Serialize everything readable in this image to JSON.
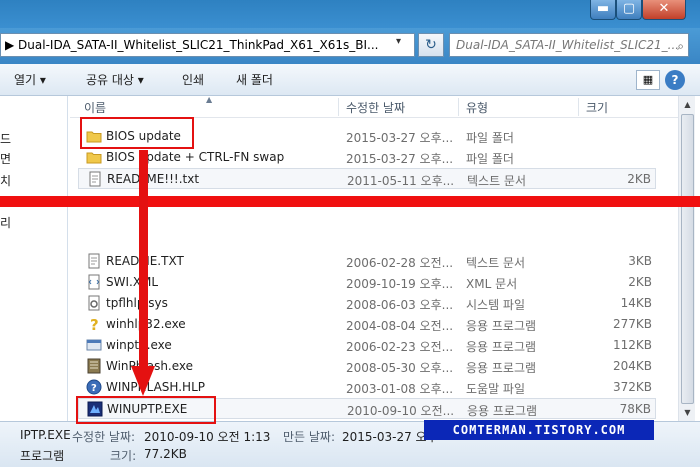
{
  "window": {
    "minimize_glyph": "▬",
    "maximize_glyph": "▢",
    "close_glyph": "✕"
  },
  "address": {
    "path": "▶ Dual-IDA_SATA-II_Whitelist_SLIC21_ThinkPad_X61_X61s_BI...",
    "chevron": "▾",
    "refresh_glyph": "↻"
  },
  "search": {
    "placeholder": "Dual-IDA_SATA-II_Whitelist_SLIC21_..."
  },
  "toolbar": {
    "open_label": "열기 ▾",
    "share_label": "공유 대상 ▾",
    "print_label": "인쇄",
    "new_folder_label": "새 폴더"
  },
  "nav": {
    "items": [
      "드",
      "면",
      "치",
      "리"
    ]
  },
  "columns": {
    "name": "이름",
    "date": "수정한 날짜",
    "type": "유형",
    "size": "크기"
  },
  "files": [
    {
      "name": "BIOS update",
      "date": "2015-03-27 오후...",
      "type": "파일 폴더",
      "size": "",
      "icon": "folder-icon"
    },
    {
      "name": "BIOS update + CTRL-FN swap",
      "date": "2015-03-27 오후...",
      "type": "파일 폴더",
      "size": "",
      "icon": "folder-icon"
    },
    {
      "name": "READ_ME!!!.txt",
      "date": "2011-05-11 오후...",
      "type": "텍스트 문서",
      "size": "2KB",
      "icon": "text-file-icon"
    },
    {
      "name": "README.TXT",
      "date": "2006-02-28 오전...",
      "type": "텍스트 문서",
      "size": "3KB",
      "icon": "text-file-icon"
    },
    {
      "name": "SWI.XML",
      "date": "2009-10-19 오후...",
      "type": "XML 문서",
      "size": "2KB",
      "icon": "xml-file-icon"
    },
    {
      "name": "tpflhlp.sys",
      "date": "2008-06-03 오후...",
      "type": "시스템 파일",
      "size": "14KB",
      "icon": "system-file-icon"
    },
    {
      "name": "winhlp32.exe",
      "date": "2004-08-04 오전...",
      "type": "응용 프로그램",
      "size": "277KB",
      "icon": "help-exe-icon"
    },
    {
      "name": "winptp.exe",
      "date": "2006-02-23 오전...",
      "type": "응용 프로그램",
      "size": "112KB",
      "icon": "exe-icon"
    },
    {
      "name": "WinPhlash.exe",
      "date": "2008-05-30 오후...",
      "type": "응용 프로그램",
      "size": "204KB",
      "icon": "flash-exe-icon"
    },
    {
      "name": "WINPHLASH.HLP",
      "date": "2003-01-08 오후...",
      "type": "도움말 파일",
      "size": "372KB",
      "icon": "help-file-icon"
    },
    {
      "name": "WINUPTP.EXE",
      "date": "2010-09-10 오전...",
      "type": "응용 프로그램",
      "size": "78KB",
      "icon": "uptp-exe-icon"
    }
  ],
  "details": {
    "name": "IPTP.EXE",
    "kind": "프로그램",
    "modified_label": "수정한 날짜:",
    "modified_value": "2010-09-10 오전 1:13",
    "created_label": "만든 날짜:",
    "created_value": "2015-03-27 오후",
    "size_label": "크기:",
    "size_value": "77.2KB"
  },
  "watermark": "COMTERMAN.TISTORY.COM",
  "colors": {
    "annotation_red": "#e41111",
    "watermark_bg": "#0b27b7"
  }
}
